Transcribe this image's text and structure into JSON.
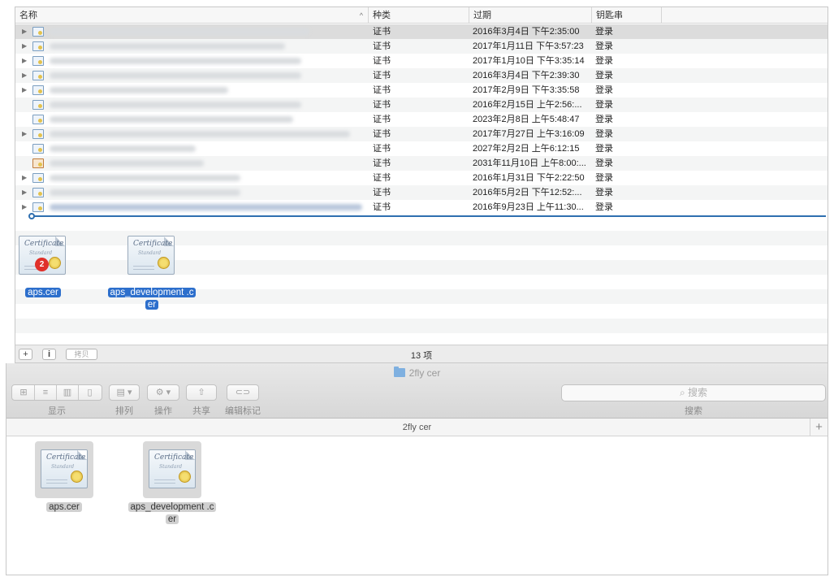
{
  "keychain": {
    "columns": {
      "name": "名称",
      "kind": "种类",
      "expires": "过期",
      "keychain": "钥匙串"
    },
    "rows": [
      {
        "kind": "证书",
        "expires": "2016年3月4日 下午2:35:00",
        "keychain": "登录",
        "disclosure": "▶"
      },
      {
        "kind": "证书",
        "expires": "2017年1月11日 下午3:57:23",
        "keychain": "登录",
        "disclosure": "▶"
      },
      {
        "kind": "证书",
        "expires": "2017年1月10日 下午3:35:14",
        "keychain": "登录",
        "disclosure": "▶"
      },
      {
        "kind": "证书",
        "expires": "2016年3月4日 下午2:39:30",
        "keychain": "登录",
        "disclosure": "▶"
      },
      {
        "kind": "证书",
        "expires": "2017年2月9日 下午3:35:58",
        "keychain": "登录",
        "disclosure": "▶"
      },
      {
        "kind": "证书",
        "expires": "2016年2月15日 上午2:56:...",
        "keychain": "登录",
        "disclosure": ""
      },
      {
        "kind": "证书",
        "expires": "2023年2月8日 上午5:48:47",
        "keychain": "登录",
        "disclosure": ""
      },
      {
        "kind": "证书",
        "expires": "2017年7月27日 上午3:16:09",
        "keychain": "登录",
        "disclosure": "▶"
      },
      {
        "kind": "证书",
        "expires": "2027年2月2日 上午6:12:15",
        "keychain": "登录",
        "disclosure": ""
      },
      {
        "kind": "证书",
        "expires": "2031年11月10日 上午8:00:...",
        "keychain": "登录",
        "disclosure": ""
      },
      {
        "kind": "证书",
        "expires": "2016年1月31日 下午2:22:50",
        "keychain": "登录",
        "disclosure": "▶"
      },
      {
        "kind": "证书",
        "expires": "2016年5月2日 下午12:52:...",
        "keychain": "登录",
        "disclosure": "▶"
      },
      {
        "kind": "证书",
        "expires": "2016年9月23日 上午11:30...",
        "keychain": "登录",
        "disclosure": "▶"
      }
    ],
    "dragged_files": {
      "file1_name": "aps.cer",
      "file2_line1": "aps_development .c",
      "file2_line2": "er",
      "drag_count_badge": "2"
    },
    "footer": {
      "add_label": "+",
      "info_label": "i",
      "copy_label": "拷贝",
      "item_count": "13 项"
    }
  },
  "finder": {
    "title": "2fly cer",
    "toolbar": {
      "view_label": "显示",
      "arrange_label": "排列",
      "action_label": "操作",
      "share_label": "共享",
      "tags_label": "编辑标记",
      "search_placeholder": "搜索",
      "search_label": "搜索"
    },
    "path_title": "2fly cer",
    "add_tab": "+",
    "files": {
      "file1_name": "aps.cer",
      "file2_line1": "aps_development .c",
      "file2_line2": "er"
    }
  },
  "icons": {
    "certificate": "certificate-icon",
    "folder": "folder-icon",
    "search": "search-icon",
    "gear": "gear-icon",
    "share": "share-icon",
    "tag": "tag-icon"
  }
}
